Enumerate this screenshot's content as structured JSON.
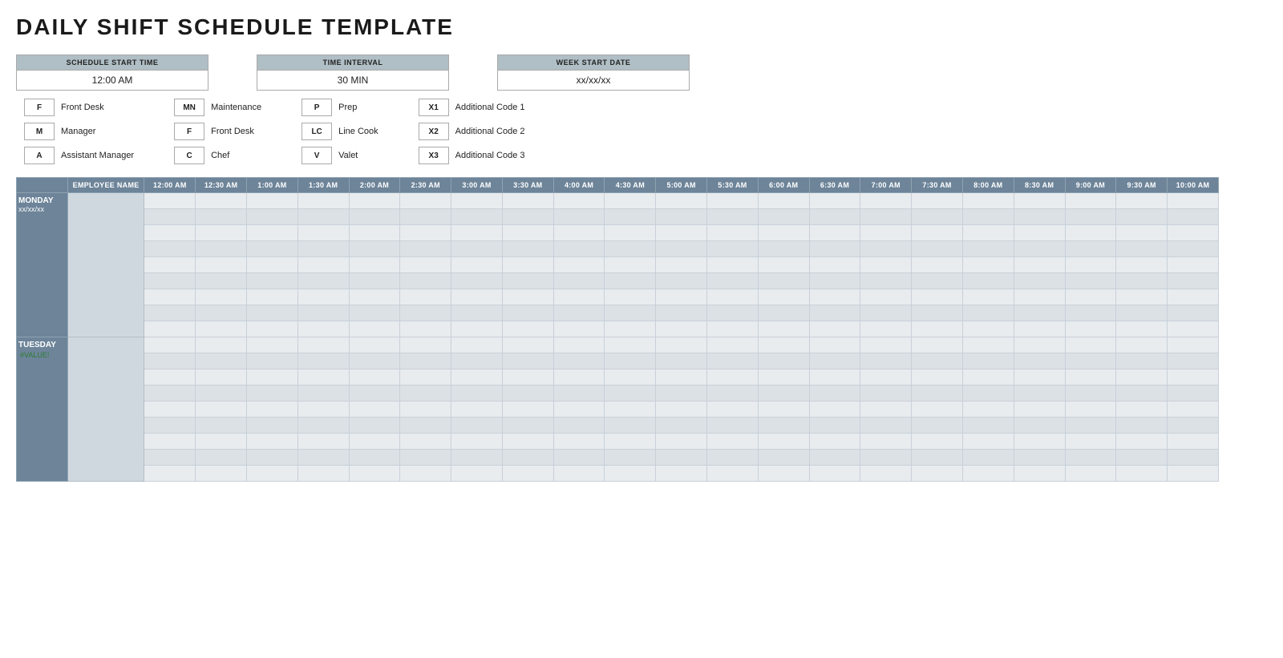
{
  "title": "DAILY SHIFT SCHEDULE TEMPLATE",
  "controls": {
    "schedule_start_time": {
      "label": "SCHEDULE START TIME",
      "value": "12:00 AM"
    },
    "time_interval": {
      "label": "TIME INTERVAL",
      "value": "30 MIN"
    },
    "week_start_date": {
      "label": "WEEK START DATE",
      "value": "xx/xx/xx"
    }
  },
  "legend": {
    "col1": [
      {
        "code": "F",
        "desc": "Front Desk"
      },
      {
        "code": "M",
        "desc": "Manager"
      },
      {
        "code": "A",
        "desc": "Assistant Manager"
      }
    ],
    "col2": [
      {
        "code": "MN",
        "desc": "Maintenance"
      },
      {
        "code": "F",
        "desc": "Front Desk"
      },
      {
        "code": "C",
        "desc": "Chef"
      }
    ],
    "col3": [
      {
        "code": "P",
        "desc": "Prep"
      },
      {
        "code": "LC",
        "desc": "Line Cook"
      },
      {
        "code": "V",
        "desc": "Valet"
      }
    ],
    "col4": [
      {
        "code": "X1",
        "desc": "Additional Code 1"
      },
      {
        "code": "X2",
        "desc": "Additional Code 2"
      },
      {
        "code": "X3",
        "desc": "Additional Code 3"
      }
    ]
  },
  "table": {
    "header": {
      "employee_name": "EMPLOYEE NAME",
      "times": [
        "12:00 AM",
        "12:30 AM",
        "1:00 AM",
        "1:30 AM",
        "2:00 AM",
        "2:30 AM",
        "3:00 AM",
        "3:30 AM",
        "4:00 AM",
        "4:30 AM",
        "5:00 AM",
        "5:30 AM",
        "6:00 AM",
        "6:30 AM",
        "7:00 AM",
        "7:30 AM",
        "8:00 AM",
        "8:30 AM",
        "9:00 AM",
        "9:30 AM",
        "10:00 AM"
      ]
    },
    "days": [
      {
        "day": "MONDAY",
        "date": "xx/xx/xx",
        "rows": 9
      },
      {
        "day": "TUESDAY",
        "date": "#VALUE!",
        "error": true,
        "rows": 9
      }
    ]
  },
  "scroll_number": "30"
}
